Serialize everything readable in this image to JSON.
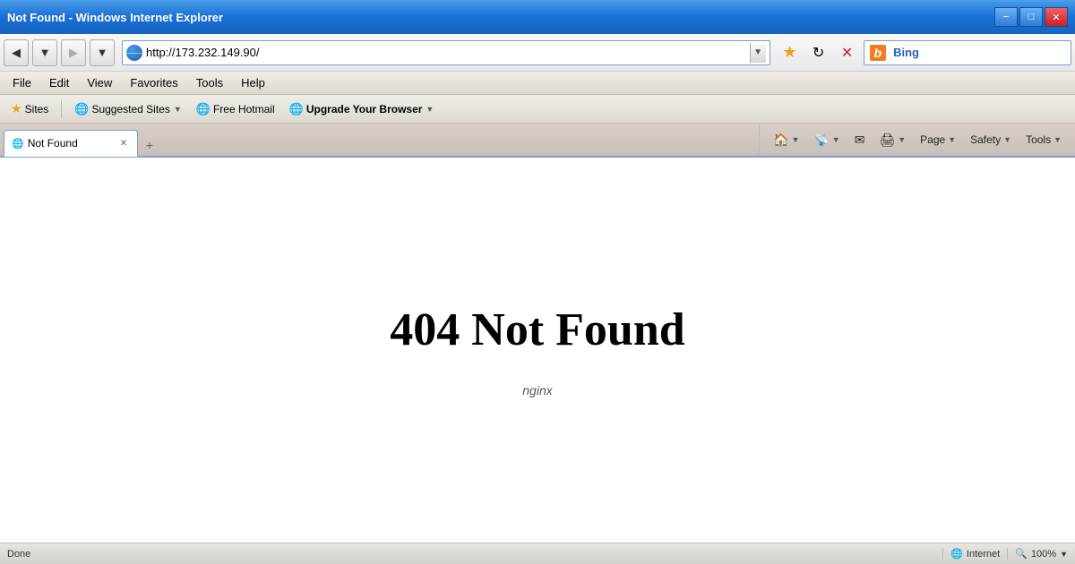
{
  "titlebar": {
    "title": "Not Found - Windows Internet Explorer",
    "minimize_label": "−",
    "maximize_label": "□",
    "close_label": "✕"
  },
  "nav": {
    "back_label": "◀",
    "forward_label": "▶",
    "dropdown_label": "▼",
    "refresh_label": "⟳",
    "stop_label": "✕",
    "address_url": "http://173.232.149.90/",
    "address_placeholder": "http://173.232.149.90/",
    "bing_logo": "b",
    "bing_label": "Bing",
    "bing_placeholder": ""
  },
  "menubar": {
    "items": [
      {
        "label": "File"
      },
      {
        "label": "Edit"
      },
      {
        "label": "View"
      },
      {
        "label": "Favorites"
      },
      {
        "label": "Tools"
      },
      {
        "label": "Help"
      }
    ]
  },
  "favoritesbar": {
    "sites_label": "Sites",
    "suggested_sites_label": "Suggested Sites",
    "suggested_dropdown": "▼",
    "free_hotmail_label": "Free Hotmail",
    "upgrade_browser_label": "Upgrade Your Browser",
    "upgrade_dropdown": "▼"
  },
  "tabs": {
    "active_tab_label": "Not Found",
    "new_tab_label": "+"
  },
  "commandbar": {
    "home_label": "Home",
    "home_dropdown": "▼",
    "feeds_label": "Feeds",
    "feeds_dropdown": "▼",
    "read_mail_label": "Read Mail",
    "print_label": "Print",
    "print_dropdown": "▼",
    "page_label": "Page",
    "page_dropdown": "▼",
    "safety_label": "Safety",
    "safety_dropdown": "▼",
    "tools_label": "Tools",
    "tools_dropdown": "▼"
  },
  "page": {
    "error_heading": "404 Not Found",
    "server_label": "nginx"
  },
  "statusbar": {
    "status_text": "Done",
    "zone_label": "Internet",
    "zoom_label": "100%"
  }
}
